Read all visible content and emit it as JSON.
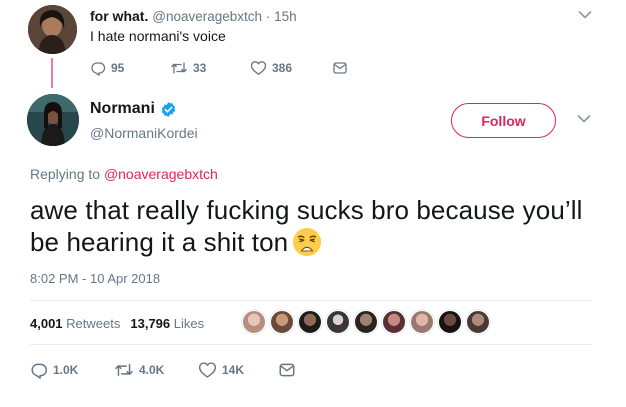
{
  "parent_tweet": {
    "display_name": "for what.",
    "handle": "@noaveragebxtch",
    "time": "· 15h",
    "text": "I hate normani's voice",
    "replies": "95",
    "retweets": "33",
    "likes": "386"
  },
  "main_tweet": {
    "display_name": "Normani",
    "handle": "@NormaniKordei",
    "follow_label": "Follow",
    "replying_prefix": "Replying to",
    "replying_to": "@noaveragebxtch",
    "text": "awe that really fucking sucks bro because you’ll be hearing it a shit ton",
    "emoji": "weary-face-emoji",
    "timestamp": "8:02 PM - 10 Apr 2018",
    "retweet_count": "4,001",
    "retweet_label": "Retweets",
    "like_count": "13,796",
    "like_label": "Likes",
    "replies": "1.0K",
    "retweets": "4.0K",
    "likes": "14K"
  },
  "colors": {
    "accent": "#e0245e",
    "verified": "#1da1f2",
    "muted": "#657786",
    "text": "#14171a"
  },
  "icons": [
    "reply-icon",
    "retweet-icon",
    "like-icon",
    "dm-icon",
    "verified-badge-icon",
    "chevron-down-icon"
  ]
}
